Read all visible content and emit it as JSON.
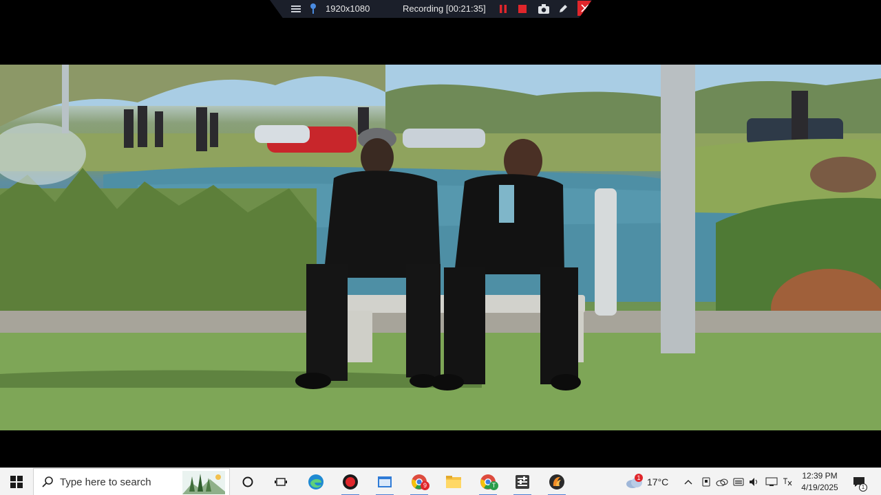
{
  "recorder": {
    "resolution": "1920x1080",
    "status": "Recording [00:21:35]",
    "icons": [
      "menu-icon",
      "pin-icon",
      "pause-icon",
      "stop-icon",
      "camera-icon",
      "pen-icon",
      "close-icon"
    ]
  },
  "taskbar": {
    "search_placeholder": "Type here to search",
    "apps": [
      {
        "name": "edge-icon"
      },
      {
        "name": "recorder-icon"
      },
      {
        "name": "window-app-icon"
      },
      {
        "name": "chrome-icon",
        "badge": "9"
      },
      {
        "name": "file-explorer-icon"
      },
      {
        "name": "chrome-profile-icon",
        "badge": "T"
      },
      {
        "name": "control-panel-icon"
      },
      {
        "name": "fl-studio-icon"
      }
    ],
    "weather": {
      "temp": "17°C",
      "badge": "1"
    },
    "time": "12:39 PM",
    "date": "4/19/2025",
    "notification_count": "1"
  },
  "colors": {
    "taskbar_bg": "#f3f3f3",
    "recorder_bg": "#1b1f2a",
    "record_red": "#e0262b",
    "accent": "#4a7fd4"
  }
}
